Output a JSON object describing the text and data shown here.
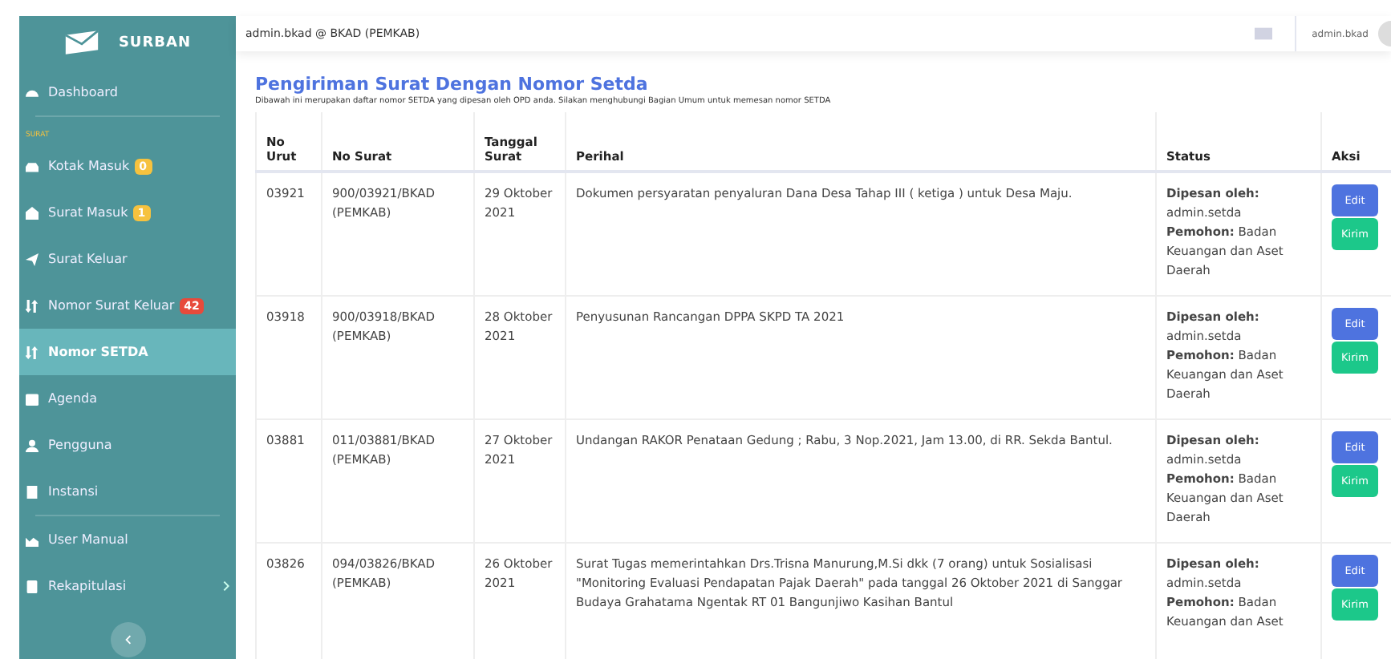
{
  "sidebar": {
    "brand": "SURBAN",
    "sections": [
      {
        "items": [
          {
            "label": "Dashboard",
            "selected": false
          }
        ]
      },
      {
        "heading": "SURAT",
        "items": [
          {
            "label": "Kotak Masuk",
            "badge": "0",
            "color": "#f6c23e",
            "selected": false
          },
          {
            "label": "Surat Masuk",
            "badge": "1",
            "color": "#f6c23e",
            "selected": false
          },
          {
            "label": "Surat Keluar",
            "selected": false
          },
          {
            "label": "Nomor Surat Keluar",
            "badge": "42",
            "color": "#e74a3b",
            "selected": false
          },
          {
            "label": "Nomor SETDA",
            "selected": true
          },
          {
            "label": "Agenda",
            "selected": false
          },
          {
            "label": "Pengguna",
            "selected": false
          },
          {
            "label": "Instansi",
            "selected": false
          }
        ]
      },
      {
        "items": [
          {
            "label": "User Manual",
            "selected": false
          },
          {
            "label": "Rekapitulasi",
            "selected": false,
            "submenu": true
          }
        ]
      }
    ]
  },
  "topbar": {
    "context": "admin.bkad @ BKAD (PEMKAB)",
    "user": "admin.bkad"
  },
  "page": {
    "title": "Pengiriman Surat Dengan Nomor Setda",
    "subtitle": "Dibawah ini merupakan daftar nomor SETDA yang dipesan oleh OPD anda. Silakan menghubungi Bagian Umum untuk memesan nomor SETDA"
  },
  "table": {
    "columns": [
      "No Urut",
      "No Surat",
      "Tanggal Surat",
      "Perihal",
      "Status",
      "Aksi"
    ],
    "rows": [
      {
        "no_urut": "03921",
        "no_surat": "900/03921/BKAD (PEMKAB)",
        "tanggal": "29 Oktober 2021",
        "perihal": "Dokumen persyaratan penyaluran Dana Desa Tahap III ( ketiga ) untuk Desa Maju.",
        "status": [
          "**Dipesan oleh:** admin.setda",
          "**Pemohon:** Badan Keuangan dan Aset Daerah"
        ],
        "actions": [
          "Edit",
          "Kirim"
        ]
      },
      {
        "no_urut": "03918",
        "no_surat": "900/03918/BKAD (PEMKAB)",
        "tanggal": "28 Oktober 2021",
        "perihal": "Penyusunan Rancangan DPPA SKPD TA 2021",
        "status": [
          "**Dipesan oleh:** admin.setda",
          "**Pemohon:** Badan Keuangan dan Aset Daerah"
        ],
        "actions": [
          "Edit",
          "Kirim"
        ]
      },
      {
        "no_urut": "03881",
        "no_surat": "011/03881/BKAD (PEMKAB)",
        "tanggal": "27 Oktober 2021",
        "perihal": "Undangan RAKOR Penataan Gedung ; Rabu, 3 Nop.2021, Jam 13.00, di RR. Sekda Bantul.",
        "status": [
          "**Dipesan oleh:** admin.setda",
          "**Pemohon:** Badan Keuangan dan Aset Daerah"
        ],
        "actions": [
          "Edit",
          "Kirim"
        ]
      },
      {
        "no_urut": "03826",
        "no_surat": "094/03826/BKAD (PEMKAB)",
        "tanggal": "26 Oktober 2021",
        "perihal": "Surat Tugas memerintahkan Drs.Trisna Manurung,M.Si dkk (7 orang) untuk Sosialisasi \"Monitoring Evaluasi Pendapatan Pajak Daerah\" pada tanggal 26 Oktober 2021 di Sanggar Budaya Grahatama Ngentak RT 01 Bangunjiwo Kasihan Bantul",
        "status": [
          "**Dipesan oleh:** admin.setda",
          "**Pemohon:** Badan Keuangan dan Aset"
        ],
        "actions": [
          "Edit",
          "Kirim"
        ]
      }
    ]
  }
}
